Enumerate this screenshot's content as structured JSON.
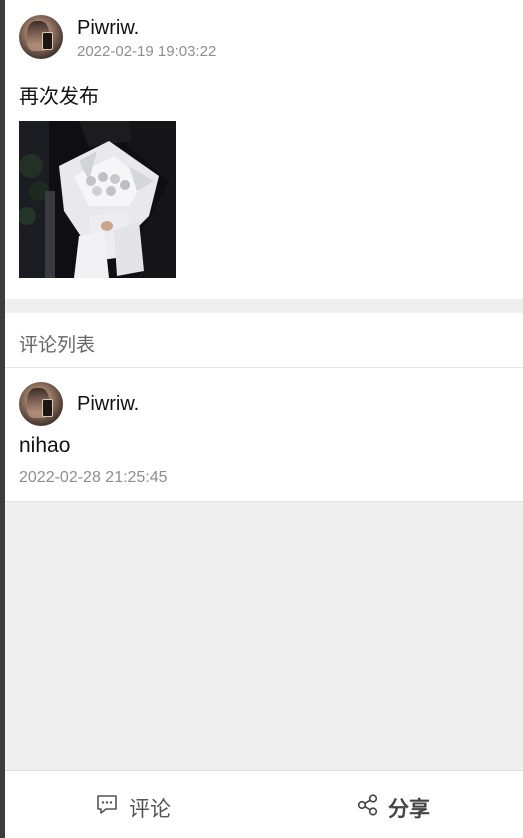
{
  "post": {
    "username": "Piwriw.",
    "time": "2022-02-19 19:03:22",
    "text": "再次发布"
  },
  "comments": {
    "title": "评论列表",
    "items": [
      {
        "username": "Piwriw.",
        "text": "nihao",
        "time": "2022-02-28 21:25:45"
      }
    ]
  },
  "bottom_bar": {
    "comment_label": "评论",
    "share_label": "分享",
    "comment_icon": "comment-bubble-icon",
    "share_icon": "share-icon"
  },
  "colors": {
    "background": "#efefef",
    "card": "#ffffff",
    "muted_text": "#8e8e8e",
    "primary_text": "#111111"
  }
}
